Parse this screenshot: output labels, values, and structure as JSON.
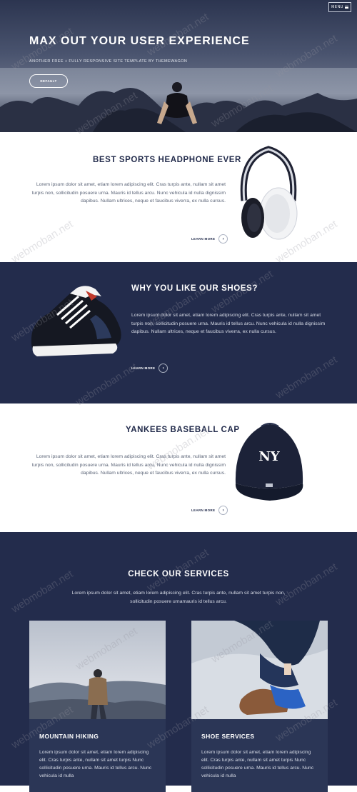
{
  "hero": {
    "menu_label": "MENU",
    "title": "MAX OUT YOUR USER EXPERIENCE",
    "subtitle": "ANOTHER FREE + FULLY RESPONSIVE SITE TEMPLATE BY THEMEWAGON",
    "button_label": "DEFAULT"
  },
  "features": [
    {
      "title": "BEST SPORTS HEADPHONE EVER",
      "text": "Lorem ipsum dolor sit amet, etiam lorem adipiscing elit. Cras turpis ante, nullam sit amet turpis non, sollicitudin posuere urna. Mauris id tellus arcu. Nunc vehicula id nulla dignissim dapibus. Nullam ultrices, neque et faucibus viverra, ex nulla cursus.",
      "link": "LEARN MORE",
      "image": "headphone-icon"
    },
    {
      "title": "WHY YOU LIKE OUR SHOES?",
      "text": "Lorem ipsum dolor sit amet, etiam lorem adipiscing elit. Cras turpis ante, nullam sit amet turpis non, sollicitudin posuere urna. Mauris id tellus arcu. Nunc vehicula id nulla dignissim dapibus. Nullam ultrices, neque et faucibus viverra, ex nulla cursus.",
      "link": "LEARN MORE",
      "image": "sneaker-icon"
    },
    {
      "title": "YANKEES BASEBALL CAP",
      "text": "Lorem ipsum dolor sit amet, etiam lorem adipiscing elit. Cras turpis ante, nullam sit amet turpis non, sollicitudin posuere urna. Mauris id tellus arcu. Nunc vehicula id nulla dignissim dapibus. Nullam ultrices, neque et faucibus viverra, ex nulla cursus.",
      "link": "LEARN MORE",
      "image": "cap-icon"
    }
  ],
  "services": {
    "title": "CHECK OUR SERVICES",
    "text": "Lorem ipsum dolor sit amet, etiam lorem adipiscing elit. Cras turpis ante, nullam sit amet turpis non, sollicitudin posuere urnamauris id tellus arcu.",
    "cards": [
      {
        "title": "MOUNTAIN HIKING",
        "text": "Lorem ipsum dolor sit amet, etiam lorem adipiscing elit. Cras turpis ante, nullam sit amet turpis Nunc sollicitudin posuere urna. Mauris id tellus arcu. Nunc vehicula id nulla"
      },
      {
        "title": "SHOE SERVICES",
        "text": "Lorem ipsum dolor sit amet, etiam lorem adipiscing elit. Cras turpis ante, nullam sit amet turpis Nunc sollicitudin posuere urna. Mauris id tellus arcu. Nunc vehicula id nulla"
      }
    ]
  },
  "watermark": "webmoban.net",
  "colors": {
    "navy": "#232c4c",
    "white": "#ffffff",
    "card": "#2b3656"
  }
}
